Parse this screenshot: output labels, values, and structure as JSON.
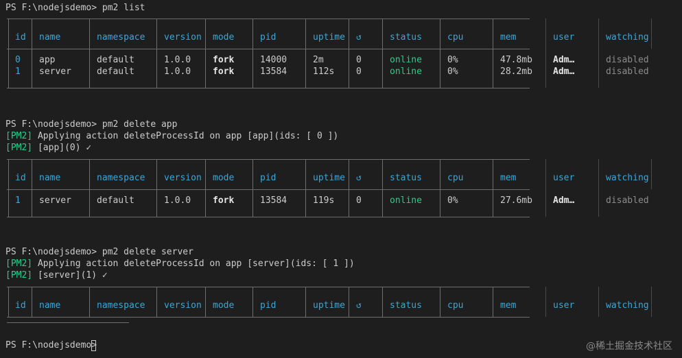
{
  "commands": {
    "list": "PS F:\\nodejsdemo> pm2 list",
    "delete_app": "PS F:\\nodejsdemo> pm2 delete app",
    "delete_server": "PS F:\\nodejsdemo> pm2 delete server",
    "prompt": "PS F:\\nodejsdemo> "
  },
  "log": {
    "tag": "[PM2]",
    "app_apply": " Applying action deleteProcessId on app [app](ids: [ 0 ])",
    "app_done": " [app](0) ✓",
    "server_apply": " Applying action deleteProcessId on app [server](ids: [ 1 ])",
    "server_done": " [server](1) ✓"
  },
  "headers": [
    "id",
    "name",
    "namespace",
    "version",
    "mode",
    "pid",
    "uptime",
    "↺",
    "status",
    "cpu",
    "mem",
    "user",
    "watching"
  ],
  "table1": [
    [
      "0",
      "app",
      "default",
      "1.0.0",
      "fork",
      "14000",
      "2m",
      "0",
      "online",
      "0%",
      "47.8mb",
      "Adm…",
      "disabled"
    ],
    [
      "1",
      "server",
      "default",
      "1.0.0",
      "fork",
      "13584",
      "112s",
      "0",
      "online",
      "0%",
      "28.2mb",
      "Adm…",
      "disabled"
    ]
  ],
  "table2": [
    [
      "1",
      "server",
      "default",
      "1.0.0",
      "fork",
      "13584",
      "119s",
      "0",
      "online",
      "0%",
      "27.6mb",
      "Adm…",
      "disabled"
    ]
  ],
  "watermark": "@稀土掘金技术社区",
  "colors": {
    "background": "#1e1e1e",
    "header": "#3ba7d8",
    "online": "#23d18b",
    "tag": "#23d18b"
  }
}
